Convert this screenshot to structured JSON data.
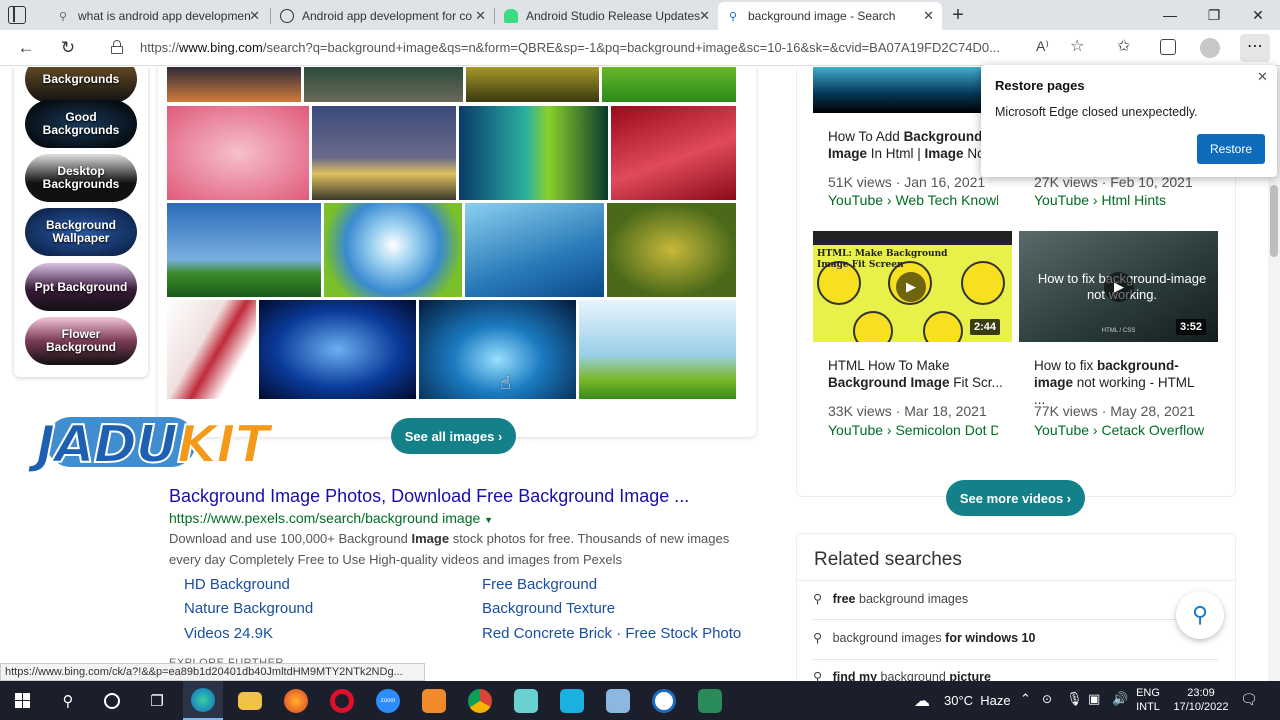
{
  "tabs": [
    {
      "title": "what is android app developmen"
    },
    {
      "title": "Android app development for co"
    },
    {
      "title": "Android Studio Release Updates"
    },
    {
      "title": "background image - Search"
    }
  ],
  "url": {
    "prefix": "https://",
    "host": "www.bing.com",
    "path": "/search?q=background+image&qs=n&form=QBRE&sp=-1&pq=background+image&sc=10-16&sk=&cvid=BA07A19FD2C74D0..."
  },
  "sidebar_pills": [
    {
      "l1": "",
      "l2": "Backgrounds"
    },
    {
      "l1": "Good",
      "l2": "Backgrounds"
    },
    {
      "l1": "Desktop",
      "l2": "Backgrounds"
    },
    {
      "l1": "Background",
      "l2": "Wallpaper"
    },
    {
      "l1": "Ppt Background",
      "l2": ""
    },
    {
      "l1": "Flower",
      "l2": "Background"
    }
  ],
  "see_all_images": "See all images",
  "watermark": {
    "part1": "JADU",
    "part2": "KIT"
  },
  "result": {
    "title": "Background Image Photos, Download Free Background Image ...",
    "url": "https://www.pexels.com/search/background image",
    "desc_before": "Download and use 100,000+ Background ",
    "desc_bold": "Image",
    "desc_after": " stock photos for free. Thousands of new images every day Completely Free to Use High-quality videos and images from Pexels",
    "links": [
      "HD Background",
      "Free Background",
      "Nature Background",
      "Background Texture",
      "Videos 24.9K",
      "Red Concrete Brick · Free Stock Photo"
    ],
    "explore": "EXPLORE FURTHER"
  },
  "videos": [
    {
      "cap_a": "How To Add ",
      "cap_b": "Background Image",
      "cap_c": " In Html | ",
      "cap_d": "Image",
      "cap_e": " No",
      "meta": "51K views · Jan 16, 2021",
      "src": "YouTube › Web Tech Knowl..."
    },
    {
      "meta": "27K views · Feb 10, 2021",
      "src": "YouTube › Html Hints"
    },
    {
      "cap_a": "HTML How To Make ",
      "cap_b": "Background Image",
      "cap_c": " Fit Scr...",
      "meta": "33K views · Mar 18, 2021",
      "src": "YouTube › Semicolon Dot D...",
      "duration": "2:44",
      "thumb_text": "HTML: Make Background Image Fit Screen"
    },
    {
      "cap_a": "How to fix ",
      "cap_b": "background-image",
      "cap_c": " not working - HTML ...",
      "meta": "77K views · May 28, 2021",
      "src": "YouTube › Cetack Overflow",
      "duration": "3:52",
      "thumb_text": "How to fix background-image not working.",
      "thumb_sub": "HTML / CSS"
    }
  ],
  "see_more_videos": "See more videos",
  "related": {
    "heading": "Related searches",
    "items": [
      {
        "b": "free",
        "t": " background images"
      },
      {
        "t": "background images ",
        "b": "for windows 10"
      },
      {
        "b": "find my",
        "t": " background ",
        "b2": "picture"
      }
    ]
  },
  "restore": {
    "title": "Restore pages",
    "message": "Microsoft Edge closed unexpectedly.",
    "button": "Restore"
  },
  "status_url": "https://www.bing.com/ck/a?!&&p=ea89b1d20401db40JmltdHM9MTY2NTk2NDg...",
  "taskbar": {
    "weather": "30°C  Haze",
    "lang1": "ENG",
    "lang2": "INTL",
    "time": "23:09",
    "date": "17/10/2022"
  }
}
